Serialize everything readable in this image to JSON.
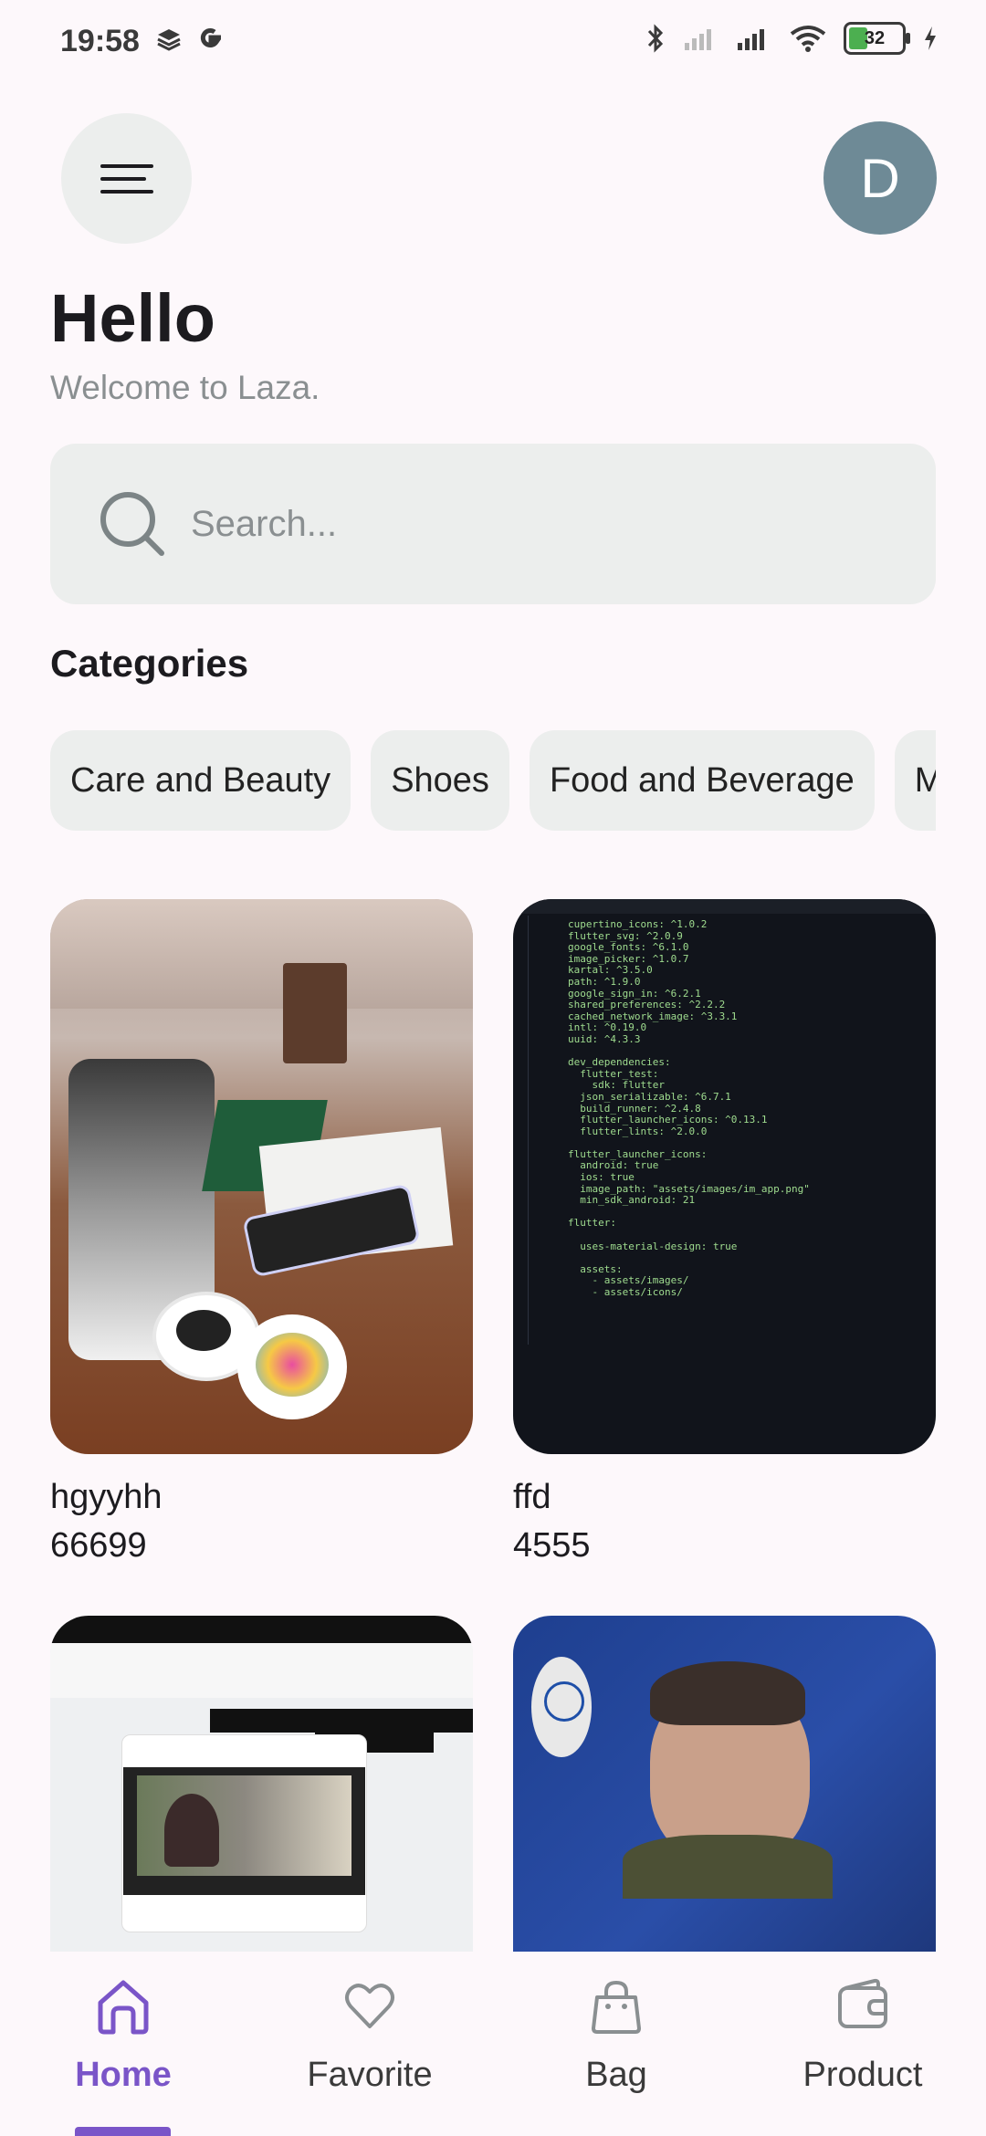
{
  "status_bar": {
    "time": "19:58",
    "battery": "32",
    "left_icons": [
      "stack-icon",
      "google-icon"
    ],
    "right_icons": [
      "bluetooth-icon",
      "signal-icon",
      "signal-icon",
      "wifi-icon",
      "battery-icon",
      "charging-icon"
    ]
  },
  "header": {
    "avatar_initial": "D",
    "title": "Hello",
    "subtitle": "Welcome to Laza."
  },
  "search": {
    "placeholder": "Search..."
  },
  "categories": {
    "title": "Categories",
    "items": [
      "Care and Beauty",
      "Shoes",
      "Food and Beverage",
      "M"
    ]
  },
  "products": [
    {
      "name": "hgyyhh",
      "price": "66699"
    },
    {
      "name": "ffd",
      "price": "4555"
    },
    {
      "name": "",
      "price": ""
    },
    {
      "name": "",
      "price": ""
    }
  ],
  "bottom_nav": {
    "items": [
      {
        "label": "Home",
        "icon": "home-icon",
        "active": true
      },
      {
        "label": "Favorite",
        "icon": "heart-icon",
        "active": false
      },
      {
        "label": "Bag",
        "icon": "bag-icon",
        "active": false
      },
      {
        "label": "Product",
        "icon": "wallet-icon",
        "active": false
      }
    ]
  },
  "colors": {
    "accent": "#7a55c8",
    "surface": "#eceeed",
    "background": "#fdf8fb",
    "avatar": "#6e8a96"
  }
}
